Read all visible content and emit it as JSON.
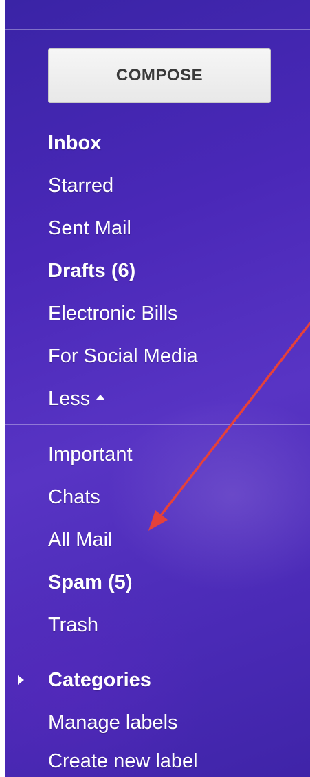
{
  "compose": {
    "label": "COMPOSE"
  },
  "nav": {
    "inbox": "Inbox",
    "starred": "Starred",
    "sent": "Sent Mail",
    "drafts": "Drafts (6)",
    "bills": "Electronic Bills",
    "social": "For Social Media",
    "less": "Less",
    "important": "Important",
    "chats": "Chats",
    "all_mail": "All Mail",
    "spam": "Spam (5)",
    "trash": "Trash",
    "categories": "Categories",
    "manage_labels": "Manage labels",
    "create_label": "Create new label"
  },
  "colors": {
    "panel_bg": "#4a2ab6",
    "arrow": "#e5413a",
    "compose_bg": "#f0f0f0"
  },
  "icons": {
    "less": "caret-up-icon",
    "categories": "caret-right-icon",
    "annotation": "red-arrow"
  }
}
